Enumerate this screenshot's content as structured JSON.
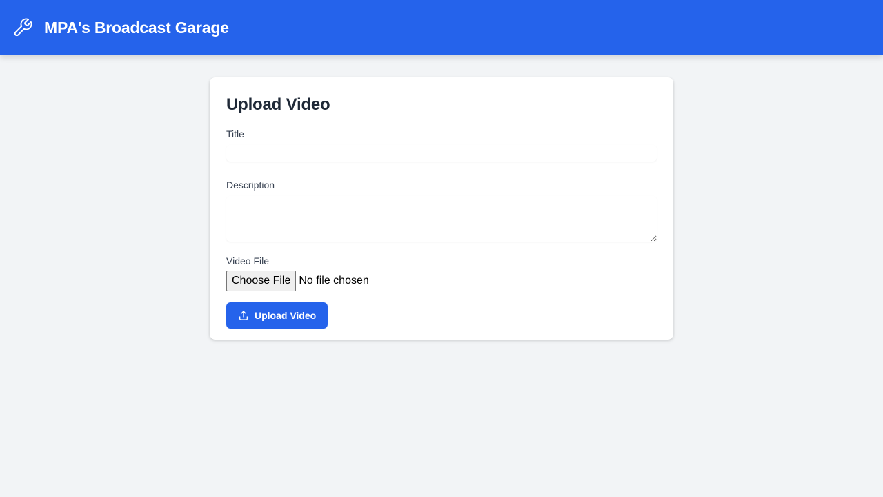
{
  "header": {
    "title": "MPA's Broadcast Garage",
    "icon": "wrench-icon",
    "background_color": "#2563eb"
  },
  "form": {
    "heading": "Upload Video",
    "title_label": "Title",
    "title_value": "",
    "description_label": "Description",
    "description_value": "",
    "file_label": "Video File",
    "choose_file_label": "Choose File",
    "file_status": "No file chosen",
    "submit_label": "Upload Video",
    "submit_icon": "upload-icon",
    "accent_color": "#2563eb"
  }
}
